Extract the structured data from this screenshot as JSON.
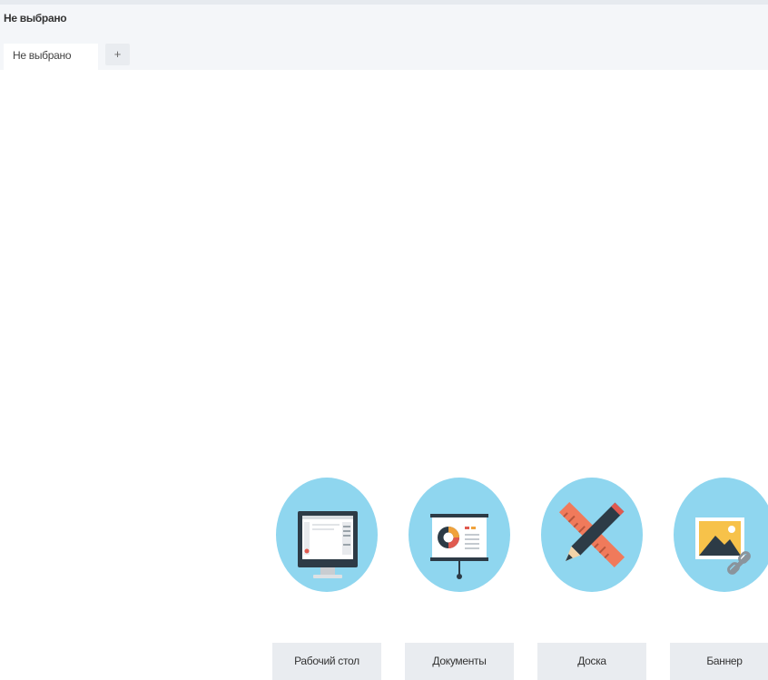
{
  "page": {
    "title": "Не выбрано"
  },
  "tabs": {
    "active_label": "Не выбрано",
    "add_label": "+"
  },
  "tiles": [
    {
      "label": "Рабочий стол",
      "icon": "desktop-monitor-icon"
    },
    {
      "label": "Документы",
      "icon": "presentation-board-icon"
    },
    {
      "label": "Доска",
      "icon": "pencil-ruler-icon"
    },
    {
      "label": "Баннер",
      "icon": "image-link-icon"
    }
  ],
  "colors": {
    "tile_circle": "#8fd6ef",
    "label_background": "#e9ecf0",
    "header_background": "#f4f6f9"
  }
}
